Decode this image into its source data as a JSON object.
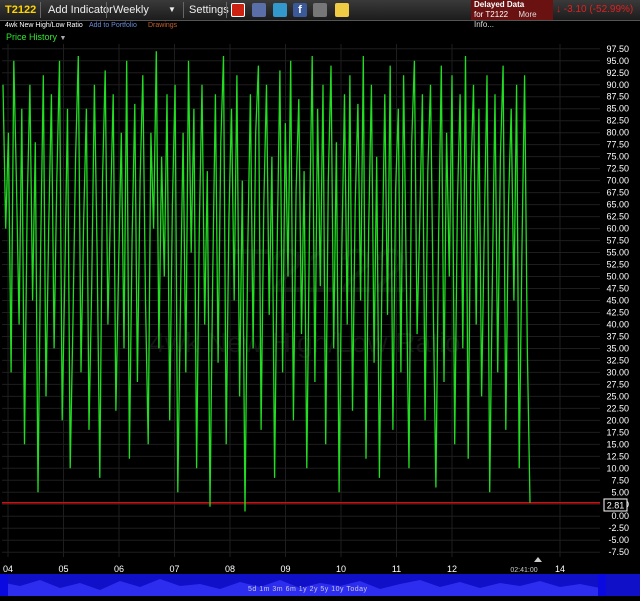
{
  "toolbar": {
    "symbol": "T2122",
    "add_indicator": "Add Indicator",
    "period": "Weekly",
    "settings": "Settings",
    "delayed_line1": "Delayed Data",
    "delayed_line2": "for T2122",
    "more_info": "More Info...",
    "change": "-3.10 (-52.99%)"
  },
  "subbar": {
    "indicator_name": "4wk New High/Low Ratio",
    "add_portfolio": "Add to Portfolio",
    "drawings": "Drawings"
  },
  "price_history_label": "Price History",
  "watermark": {
    "symbol": "T2122",
    "name": "4wk New High/Low Ratio"
  },
  "time_label": "02:41:00",
  "periods_text": "5d 1m 3m 6m 1y 2y 5y 10y Today",
  "colors": {
    "line": "#22dd22",
    "reference": "#cc1010",
    "grid": "#1e1e1e",
    "axis_text": "#ffffff",
    "scroll": "#1010c8"
  },
  "chart_data": {
    "type": "line",
    "x_tick_labels": [
      "04",
      "05",
      "06",
      "07",
      "08",
      "09",
      "10",
      "11",
      "12",
      "14"
    ],
    "y_ticks": [
      97.5,
      95,
      92.5,
      90,
      87.5,
      85,
      82.5,
      80,
      77.5,
      75,
      72.5,
      70,
      67.5,
      65,
      62.5,
      60,
      57.5,
      55,
      52.5,
      50,
      47.5,
      45,
      42.5,
      40,
      37.5,
      35,
      32.5,
      30,
      27.5,
      25,
      22.5,
      20,
      17.5,
      15,
      12.5,
      10,
      7.5,
      5,
      2.5,
      0,
      -2.5,
      -5,
      -7.5
    ],
    "ylim": [
      -8.5,
      98.5
    ],
    "last_value": "2.81",
    "reference_level": 2.81,
    "grid": true,
    "series": [
      {
        "values": [
          90,
          60,
          80,
          30,
          95,
          70,
          40,
          85,
          15,
          65,
          90,
          45,
          78,
          5,
          55,
          92,
          25,
          60,
          88,
          35,
          70,
          95,
          20,
          50,
          85,
          10,
          40,
          75,
          96,
          30,
          62,
          85,
          18,
          48,
          90,
          55,
          8,
          70,
          93,
          40,
          65,
          88,
          22,
          52,
          80,
          35,
          95,
          12,
          58,
          86,
          28,
          70,
          92,
          45,
          15,
          80,
          60,
          97,
          35,
          75,
          50,
          88,
          20,
          65,
          90,
          5,
          45,
          80,
          30,
          95,
          55,
          85,
          10,
          60,
          90,
          40,
          72,
          2,
          50,
          88,
          32,
          78,
          96,
          15,
          62,
          85,
          45,
          92,
          25,
          70,
          1,
          55,
          88,
          35,
          80,
          94,
          18,
          65,
          90,
          42,
          75,
          8,
          58,
          93,
          30,
          82,
          50,
          95,
          20,
          68,
          87,
          38,
          72,
          10,
          60,
          96,
          28,
          85,
          48,
          90,
          15,
          70,
          94,
          35,
          78,
          5,
          55,
          88,
          40,
          92,
          22,
          65,
          86,
          45,
          96,
          12,
          60,
          90,
          32,
          75,
          8,
          52,
          88,
          42,
          94,
          18,
          68,
          85,
          30,
          92,
          50,
          10,
          78,
          95,
          38,
          62,
          88,
          20,
          72,
          90,
          45,
          6,
          58,
          94,
          28,
          80,
          50,
          92,
          15,
          65,
          88,
          35,
          96,
          12,
          70,
          90,
          40,
          85,
          25,
          60,
          92,
          5,
          50,
          88,
          30,
          75,
          94,
          18,
          65,
          85,
          45,
          90,
          10,
          55,
          92,
          35,
          2.81
        ]
      }
    ]
  }
}
